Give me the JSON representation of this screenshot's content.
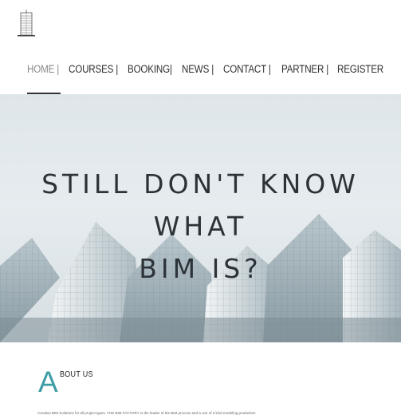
{
  "nav": {
    "items": [
      {
        "label": "HOME |"
      },
      {
        "label": "COURSES |"
      },
      {
        "label": "BOOKING|"
      },
      {
        "label": "NEWS |"
      },
      {
        "label": "CONTACT |"
      },
      {
        "label": "PARTNER |"
      },
      {
        "label": "REGISTER"
      }
    ]
  },
  "hero": {
    "line1": "STILL DON'T KNOW WHAT",
    "line2": "BIM IS?"
  },
  "about": {
    "initial": "A",
    "heading": "BOUT US",
    "paragraph": "Creative BIM Solutions for all project types. THE BIM FACTORY is the leader of the BIM process and a one of a kind modeling production"
  },
  "colors": {
    "accent": "#3d9ca6",
    "text": "#2c3338"
  }
}
